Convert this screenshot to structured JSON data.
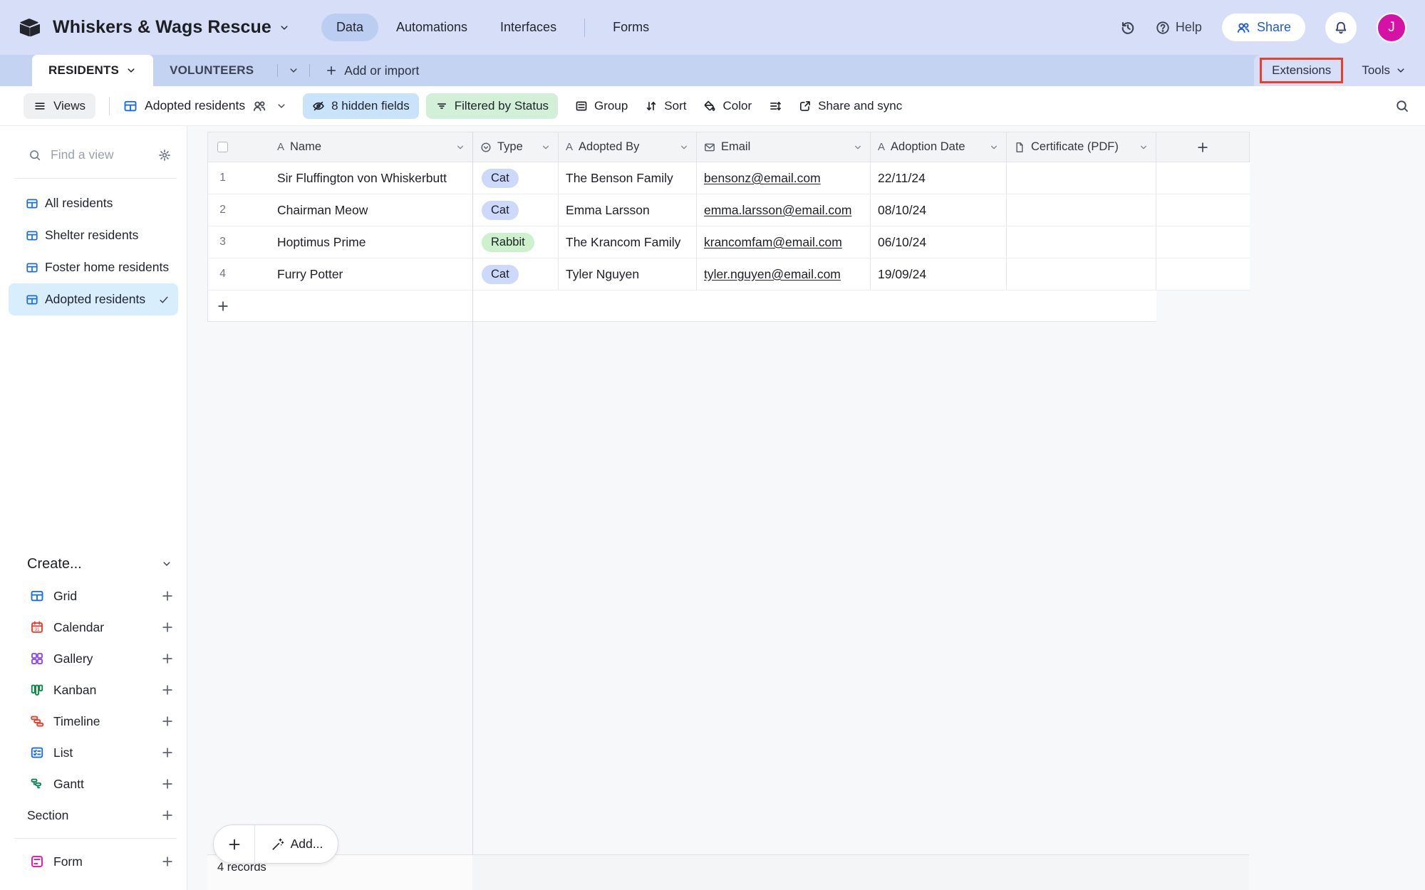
{
  "topbar": {
    "app_title": "Whiskers & Wags Rescue",
    "nav": [
      {
        "label": "Data",
        "active": true
      },
      {
        "label": "Automations",
        "active": false
      },
      {
        "label": "Interfaces",
        "active": false
      },
      {
        "label": "Forms",
        "active": false,
        "divider_before": true
      }
    ],
    "help_label": "Help",
    "share_label": "Share",
    "avatar_initial": "J"
  },
  "tabbar": {
    "tabs": [
      {
        "label": "RESIDENTS",
        "active": true
      },
      {
        "label": "VOLUNTEERS",
        "active": false
      }
    ],
    "add_label": "Add or import",
    "extensions_label": "Extensions",
    "tools_label": "Tools"
  },
  "toolbar": {
    "views_label": "Views",
    "view_name": "Adopted residents",
    "hidden_fields_label": "8 hidden fields",
    "filter_label": "Filtered by Status",
    "group_label": "Group",
    "sort_label": "Sort",
    "color_label": "Color",
    "share_sync_label": "Share and sync"
  },
  "sidebar": {
    "find_placeholder": "Find a view",
    "views": [
      {
        "label": "All residents",
        "selected": false
      },
      {
        "label": "Shelter residents",
        "selected": false
      },
      {
        "label": "Foster home residents",
        "selected": false
      },
      {
        "label": "Adopted residents",
        "selected": true
      }
    ],
    "create_label": "Create...",
    "create_items": [
      {
        "label": "Grid",
        "icon": "grid-view-icon",
        "color": "#1b6ce1"
      },
      {
        "label": "Calendar",
        "icon": "calendar-icon",
        "color": "#ef3b2d"
      },
      {
        "label": "Gallery",
        "icon": "gallery-icon",
        "color": "#8b46ff"
      },
      {
        "label": "Kanban",
        "icon": "kanban-icon",
        "color": "#0d8744"
      },
      {
        "label": "Timeline",
        "icon": "timeline-icon",
        "color": "#ef3b2d"
      },
      {
        "label": "List",
        "icon": "list-view-icon",
        "color": "#1b6ce1"
      },
      {
        "label": "Gantt",
        "icon": "gantt-icon",
        "color": "#0b8757"
      },
      {
        "label": "Section",
        "icon": null,
        "color": null
      }
    ],
    "form_item": {
      "label": "Form",
      "icon": "form-icon",
      "color": "#dd14a8"
    }
  },
  "table": {
    "columns": [
      {
        "label": "Name",
        "type_icon": "field-text-icon"
      },
      {
        "label": "Type",
        "type_icon": "field-select-icon"
      },
      {
        "label": "Adopted By",
        "type_icon": "field-text-icon"
      },
      {
        "label": "Email",
        "type_icon": "field-email-icon"
      },
      {
        "label": "Adoption Date",
        "type_icon": "field-text-icon"
      },
      {
        "label": "Certificate (PDF)",
        "type_icon": "field-file-icon"
      }
    ],
    "rows": [
      {
        "num": "1",
        "name": "Sir Fluffington von Whiskerbutt",
        "type": "Cat",
        "type_color": "#ccd9fb",
        "adopted_by": "The Benson Family",
        "email": "bensonz@email.com",
        "date": "22/11/24",
        "certificate": ""
      },
      {
        "num": "2",
        "name": "Chairman Meow",
        "type": "Cat",
        "type_color": "#ccd9fb",
        "adopted_by": "Emma Larsson",
        "email": "emma.larsson@email.com",
        "date": "08/10/24",
        "certificate": ""
      },
      {
        "num": "3",
        "name": "Hoptimus Prime",
        "type": "Rabbit",
        "type_color": "#cdf0cd",
        "adopted_by": "The Krancom Family",
        "email": "krancomfam@email.com",
        "date": "06/10/24",
        "certificate": ""
      },
      {
        "num": "4",
        "name": "Furry Potter",
        "type": "Cat",
        "type_color": "#ccd9fb",
        "adopted_by": "Tyler Nguyen",
        "email": "tyler.nguyen@email.com",
        "date": "19/09/24",
        "certificate": ""
      }
    ],
    "record_count": "4 records",
    "add_button_label": "Add..."
  },
  "colors": {
    "annotation_red": "#e8402a",
    "accent_blue": "#1b6ce1",
    "avatar_pink": "#d611a6",
    "selected_view_bg": "#d8eefd",
    "hidden_fields_bg": "#c9e4fa",
    "filter_bg": "#d2f0d8"
  }
}
